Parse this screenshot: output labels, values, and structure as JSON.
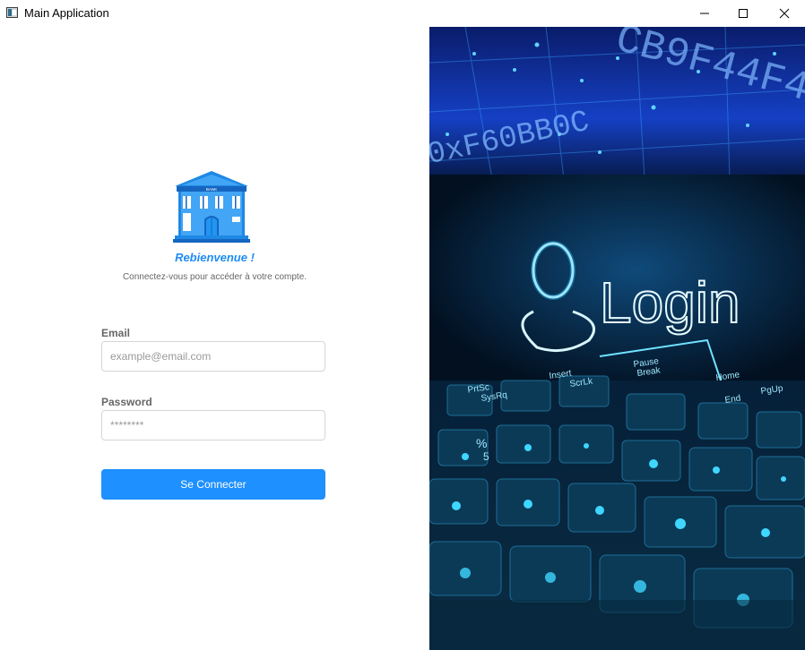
{
  "window": {
    "title": "Main Application",
    "controls": {
      "minimize": "minimize-icon",
      "maximize": "maximize-icon",
      "close": "close-icon"
    }
  },
  "login": {
    "logo_icon": "bank-building-icon",
    "logo_text": "BANK",
    "welcome": "Rebienvenue !",
    "subtitle": "Connectez-vous pour accéder à votre compte.",
    "email_label": "Email",
    "email_placeholder": "example@email.com",
    "email_value": "",
    "password_label": "Password",
    "password_placeholder": "********",
    "password_value": "",
    "submit_label": "Se Connecter"
  },
  "hero": {
    "hex_text": "0xF60BB0C",
    "hex_text_2": "CB9F44F4",
    "login_text": "Login",
    "keys": [
      "PrtSc",
      "SysRq",
      "Insert",
      "ScrLk",
      "Pause",
      "Break",
      "Home",
      "End",
      "PgUp",
      "%",
      "5"
    ],
    "icons": [
      "user-icon",
      "keyboard-icon"
    ]
  },
  "colors": {
    "accent": "#1e90ff",
    "welcome": "#1e8bf5",
    "hero_glow": "#28c8ff",
    "hero_bg": "#03101f"
  }
}
